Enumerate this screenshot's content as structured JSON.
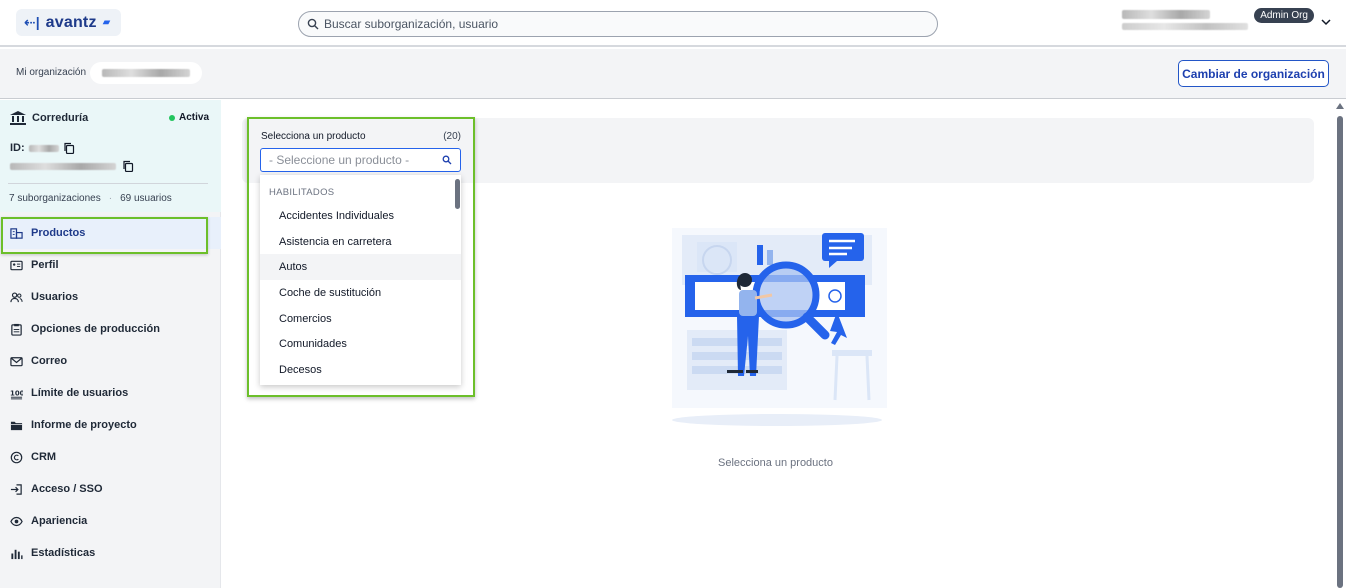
{
  "brand": {
    "name": "avantz"
  },
  "search": {
    "placeholder": "Buscar suborganización, usuario"
  },
  "user": {
    "role_badge": "Admin Org"
  },
  "orgbar": {
    "label": "Mi organización",
    "change_button": "Cambiar de organización"
  },
  "sidebar": {
    "org_type": "Correduría",
    "status": "Activa",
    "status_color": "#22c55e",
    "id_label": "ID:",
    "suborgs": "7 suborganizaciones",
    "users": "69 usuarios",
    "items": [
      {
        "label": "Productos",
        "icon": "products-icon",
        "active": true
      },
      {
        "label": "Perfil",
        "icon": "profile-card-icon"
      },
      {
        "label": "Usuarios",
        "icon": "users-icon"
      },
      {
        "label": "Opciones de producción",
        "icon": "clipboard-icon"
      },
      {
        "label": "Correo",
        "icon": "mail-icon"
      },
      {
        "label": "Límite de usuarios",
        "icon": "hundred-icon"
      },
      {
        "label": "Informe de proyecto",
        "icon": "folder-icon"
      },
      {
        "label": "CRM",
        "icon": "copyright-icon"
      },
      {
        "label": "Acceso / SSO",
        "icon": "login-icon"
      },
      {
        "label": "Apariencia",
        "icon": "eye-icon"
      },
      {
        "label": "Estadísticas",
        "icon": "bar-stats-icon"
      }
    ]
  },
  "product_selector": {
    "label": "Selecciona un producto",
    "count": "(20)",
    "placeholder": "- Seleccione un producto -",
    "group": "HABILITADOS",
    "options": [
      "Accidentes Individuales",
      "Asistencia en carretera",
      "Autos",
      "Coche de sustitución",
      "Comercios",
      "Comunidades",
      "Decesos"
    ]
  },
  "empty_state": {
    "text": "Selecciona un producto"
  },
  "colors": {
    "accent": "#1e40af",
    "highlight": "#6cbf2a",
    "illustration_blue": "#2563eb"
  }
}
